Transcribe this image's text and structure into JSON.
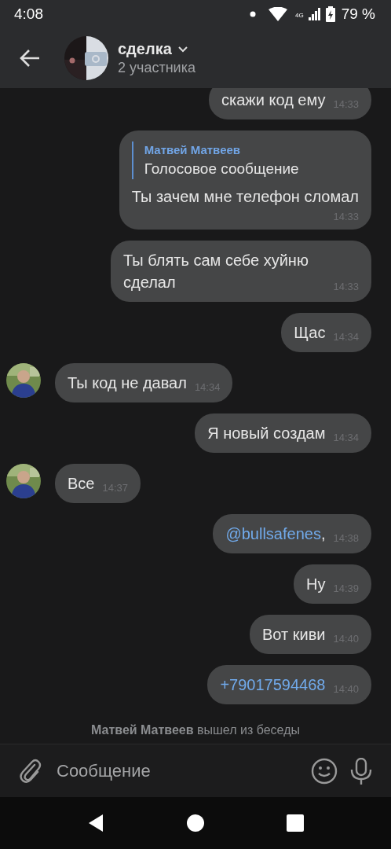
{
  "status_bar": {
    "time": "4:08",
    "network": "4G",
    "battery": "79 %"
  },
  "header": {
    "title": "сделка",
    "subtitle": "2 участника"
  },
  "messages": [
    {
      "kind": "outgoing",
      "text": "скажи код ему",
      "time": "14:33"
    },
    {
      "kind": "outgoing",
      "reply": {
        "author": "Матвей Матвеев",
        "text": "Голосовое сообщение"
      },
      "text": "Ты зачем мне телефон сломал",
      "time": "14:33"
    },
    {
      "kind": "outgoing",
      "text": "Ты блять сам себе хуйню сделал",
      "time": "14:33"
    },
    {
      "kind": "outgoing",
      "text": "Щас",
      "time": "14:34"
    },
    {
      "kind": "incoming",
      "text": "Ты код не давал",
      "time": "14:34"
    },
    {
      "kind": "outgoing",
      "text": "Я новый создам",
      "time": "14:34"
    },
    {
      "kind": "incoming",
      "text": "Все",
      "time": "14:37"
    },
    {
      "kind": "outgoing",
      "link": "@bullsafenes",
      "text": ",",
      "time": "14:38"
    },
    {
      "kind": "outgoing",
      "text": "Ну",
      "time": "14:39"
    },
    {
      "kind": "outgoing",
      "text": "Вот киви",
      "time": "14:40"
    },
    {
      "kind": "outgoing",
      "link": "+79017594468",
      "time": "14:40"
    }
  ],
  "system_message": "**Матвей Матвеев** вышел из беседы",
  "composer": {
    "placeholder": "Сообщение"
  }
}
